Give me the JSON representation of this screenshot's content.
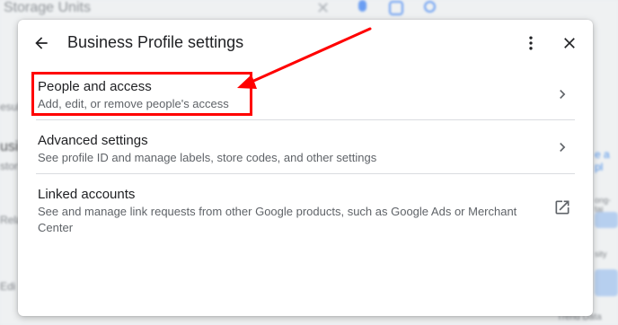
{
  "background": {
    "search_query": "Storage Units",
    "fragments": [
      "esul",
      "usi",
      "stor",
      "Rela",
      "Edi",
      "e a pl",
      "ong-tai",
      "sity",
      "Trend Data"
    ]
  },
  "dialog": {
    "title": "Business Profile settings",
    "header_icons": {
      "back": "arrow-left-icon",
      "more": "more-vert-icon",
      "close": "close-icon"
    },
    "items": [
      {
        "title": "People and access",
        "subtitle": "Add, edit, or remove people's access",
        "icon": "chevron-right-icon"
      },
      {
        "title": "Advanced settings",
        "subtitle": "See profile ID and manage labels, store codes, and other settings",
        "icon": "chevron-right-icon"
      },
      {
        "title": "Linked accounts",
        "subtitle": "See and manage link requests from other Google products, such as Google Ads or Merchant Center",
        "icon": "open-in-new-icon"
      }
    ]
  },
  "annotation": {
    "color": "#ff0000",
    "highlighted_item": "People and access"
  },
  "colors": {
    "title_text": "#202124",
    "secondary_text": "#5f6368",
    "icon": "#5f6368",
    "divider": "#dadce0",
    "google_blue": "#4285f4"
  }
}
